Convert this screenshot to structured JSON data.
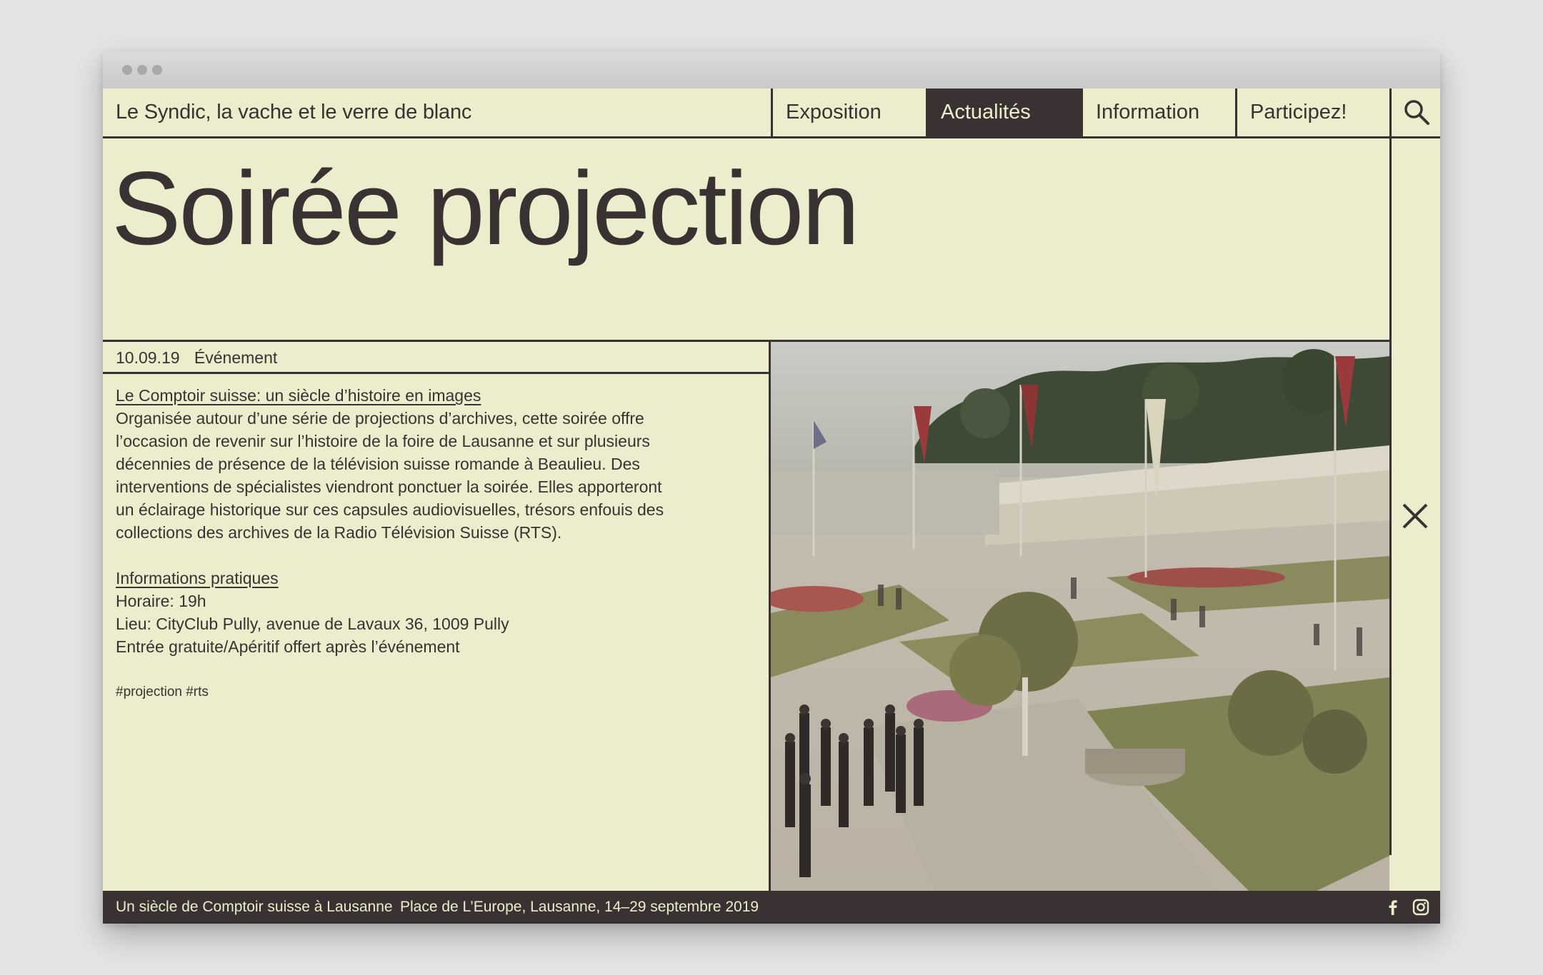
{
  "site": {
    "title": "Le Syndic, la vache et le verre de blanc"
  },
  "nav": {
    "items": [
      {
        "label": "Exposition"
      },
      {
        "label": "Actualités"
      },
      {
        "label": "Information"
      },
      {
        "label": "Participez!"
      }
    ],
    "active": "Actualités",
    "search_icon": "search-icon"
  },
  "article": {
    "title": "Soirée projection",
    "date": "10.09.19",
    "category": "Événement",
    "subtitle": "Le Comptoir suisse: un siècle d’histoire en images",
    "body": [
      "Organisée autour d’une série de projections d’archives, cette soirée offre",
      "l’occasion de revenir sur l’histoire de la foire de Lausanne et sur plusieurs",
      "décennies de présence de la télévision suisse romande à Beaulieu. Des",
      "interventions de spécialistes viendront ponctuer la soirée. Elles apporteront",
      "un éclairage historique sur ces capsules audiovisuelles, trésors enfouis des",
      "collections des archives de la Radio Télévision Suisse (RTS)."
    ],
    "info_heading": "Informations pratiques",
    "info": [
      "Horaire: 19h",
      "Lieu: CityClub Pully, avenue de Lavaux 36, 1009 Pully",
      "Entrée gratuite/Apéritif offert après l’événement"
    ],
    "tags": "#projection #rts"
  },
  "footer": {
    "left": "Un siècle de Comptoir suisse à Lausanne",
    "right": "Place de L’Europe, Lausanne, 14–29 septembre 2019",
    "social": [
      "facebook-icon",
      "instagram-icon"
    ]
  },
  "colors": {
    "background": "#ecedcc",
    "ink": "#3a3232",
    "page": "#e4e4e4"
  }
}
